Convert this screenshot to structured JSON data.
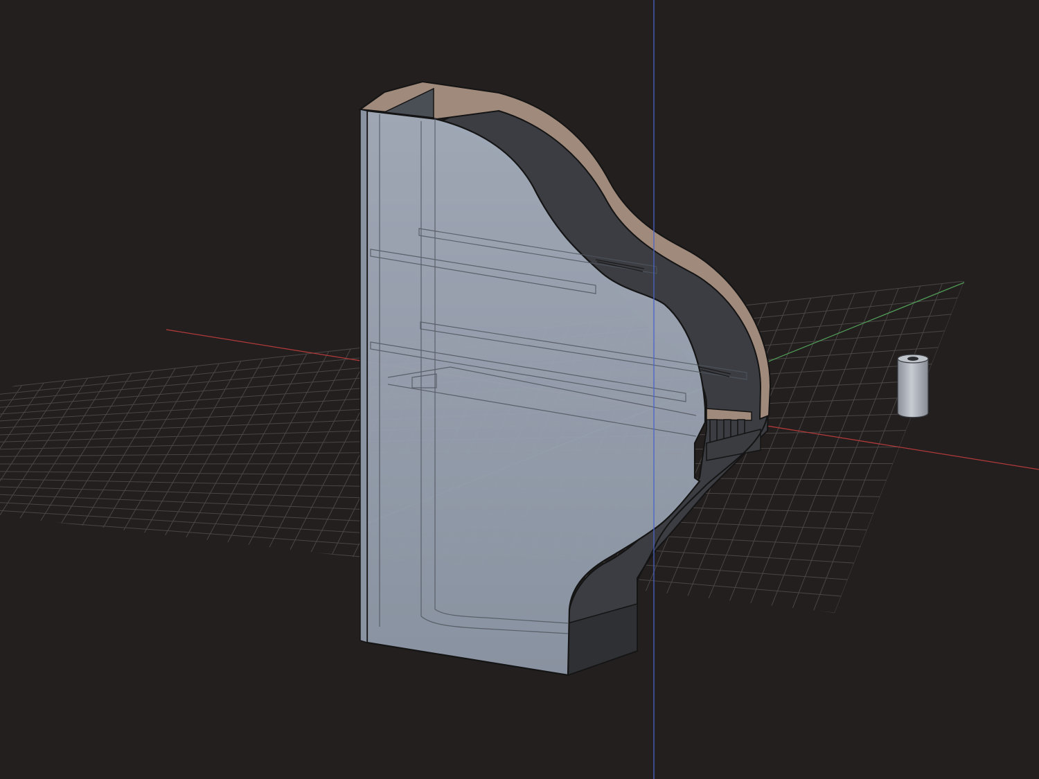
{
  "app": {
    "view": "3d-perspective-viewport"
  },
  "colors": {
    "background": "#241f1f",
    "grid_line": "#4a4646",
    "axis_x": "#b23a3a",
    "axis_y": "#4f9a55",
    "axis_z": "#4a63c9",
    "model_face": "#9aa3b1",
    "model_face_shade": "#7f8795",
    "model_edge": "#141414",
    "cut_section": "#a08a7c",
    "inner_wall": "#4a4e55",
    "bottom_block": "#3a3c40"
  },
  "scene": {
    "objects": [
      {
        "name": "case-body",
        "icon": "solid-body-icon"
      },
      {
        "name": "spacer-cylinder",
        "icon": "cylinder-icon"
      }
    ],
    "grid_visible": true,
    "axes_visible": true
  }
}
